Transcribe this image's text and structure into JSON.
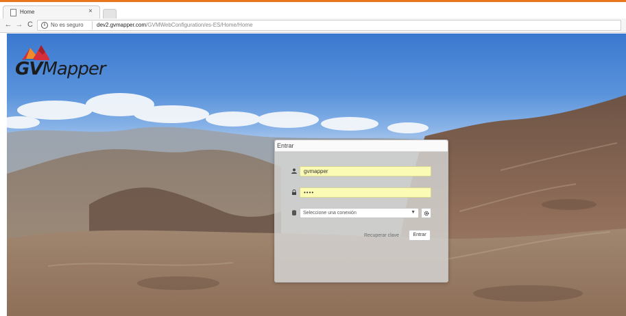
{
  "browser": {
    "tab": {
      "title": "Home",
      "close_glyph": "×",
      "favicon": "page-icon"
    },
    "nav": {
      "back_glyph": "←",
      "forward_glyph": "→",
      "reload_glyph": "C"
    },
    "address": {
      "info_glyph": "i",
      "security_label": "No es seguro",
      "url_host": "dev2.gvmapper.com",
      "url_path": "/GVMWebConfiguration/es-ES/Home/Home"
    },
    "accent_color": "#e8771e"
  },
  "logo": {
    "text_bold": "GV",
    "text_rest": "Mapper"
  },
  "login": {
    "title": "Entrar",
    "username_value": "gvmapper",
    "password_value": "••••",
    "connection_placeholder": "Seleccione una conexión",
    "recover_label": "Recuperar clave",
    "submit_label": "Entrar"
  },
  "icons": {
    "username": "user-icon",
    "password": "lock-icon",
    "connection": "database-icon",
    "config": "gear-icon"
  }
}
